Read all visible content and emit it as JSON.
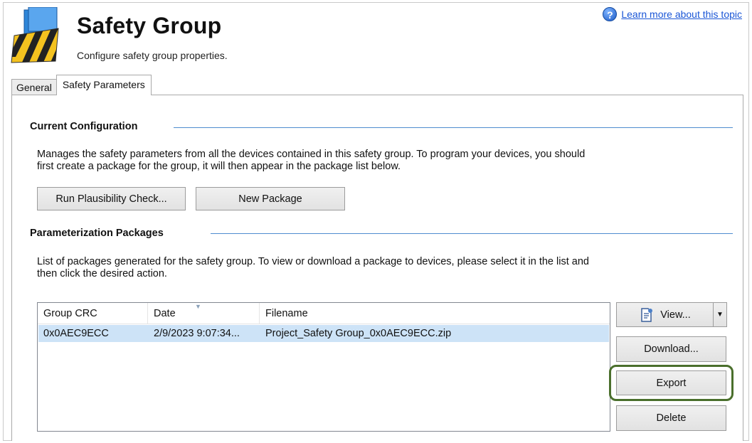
{
  "header": {
    "title": "Safety Group",
    "subtitle": "Configure safety group properties.",
    "help_link": "Learn more about this topic",
    "help_icon": "question-mark-icon",
    "logo_icon": "safety-folder-icon"
  },
  "tabs": [
    {
      "label": "General",
      "active": false
    },
    {
      "label": "Safety Parameters",
      "active": true
    }
  ],
  "current_configuration": {
    "title": "Current Configuration",
    "description_line1": "Manages the safety parameters from all the devices contained in this safety group.  To program your devices, you should",
    "description_line2": "first create a package for the group, it will then appear in the package list below.",
    "run_check_label": "Run Plausibility Check...",
    "new_package_label": "New Package"
  },
  "packages": {
    "title": "Parameterization Packages",
    "description_line1": "List of packages generated for the safety group.  To view or download a package to devices, please select it in the list and",
    "description_line2": "then click the desired action.",
    "columns": [
      "Group CRC",
      "Date",
      "Filename"
    ],
    "rows": [
      {
        "crc": "0x0AEC9ECC",
        "date": "2/9/2023 9:07:34...",
        "filename": "Project_Safety Group_0x0AEC9ECC.zip",
        "selected": true
      }
    ],
    "view_label": "View...",
    "download_label": "Download...",
    "export_label": "Export",
    "delete_label": "Delete"
  },
  "colors": {
    "section_line": "#4f8ccf",
    "selected_row": "#cde3f7",
    "export_highlight": "#4a6f2c",
    "link": "#1a56d6"
  }
}
